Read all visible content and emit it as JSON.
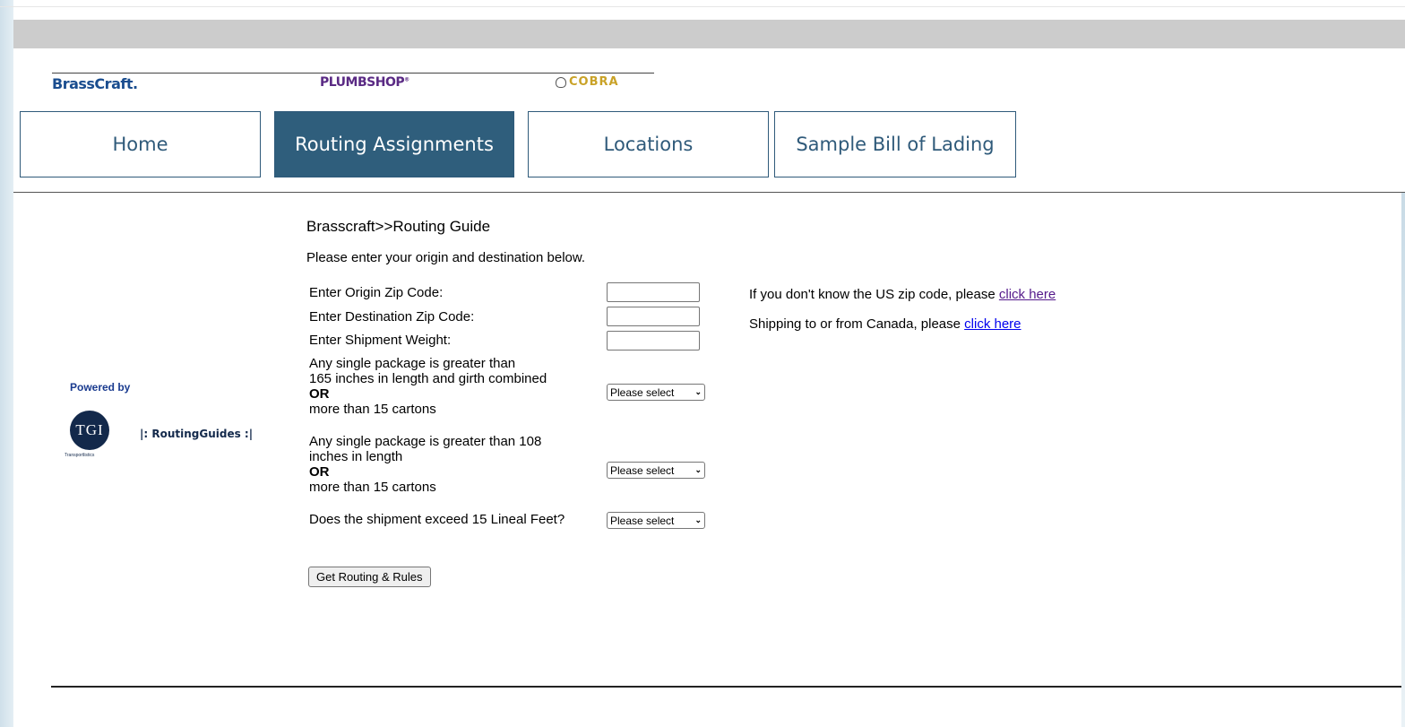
{
  "brands": {
    "brasscraft": "BrassCraft.",
    "plumbshop": "PLUMBSHOP",
    "plumbshop_mark": "®",
    "cobra": "COBRA"
  },
  "nav": {
    "tabs": [
      {
        "label": "Home"
      },
      {
        "label": "Routing Assignments",
        "active": true
      },
      {
        "label": "Locations"
      },
      {
        "label": "Sample Bill of Lading"
      }
    ]
  },
  "sidebar": {
    "powered_by": "Powered by",
    "tgi_logo": "TGI",
    "tgi_sub": "Transportlistics",
    "routingguides_logo": "|: RoutingGuides :|"
  },
  "main": {
    "breadcrumb": "Brasscraft>>Routing Guide",
    "intro": "Please enter your origin and destination below.",
    "fields": {
      "origin_label": "Enter Origin Zip Code:",
      "origin_value": "",
      "destination_label": "Enter Destination Zip Code:",
      "destination_value": "",
      "weight_label": "Enter Shipment Weight:",
      "weight_value": ""
    },
    "questions": {
      "q1_line1": "Any single package is greater than",
      "q1_line2": "165 inches in length and girth combined",
      "q1_or": "OR",
      "q1_line3": "more than 15 cartons",
      "q2_line1": "Any single package is greater than 108",
      "q2_line2": "inches in length",
      "q2_or": "OR",
      "q2_line3": "more than 15 cartons",
      "q3": "Does the shipment exceed 15 Lineal Feet?"
    },
    "select_placeholder": "Please select",
    "submit_label": "Get Routing & Rules"
  },
  "help": {
    "zip_text": "If you don't know the US zip code, please ",
    "zip_link": "click here",
    "canada_text": "Shipping to or from Canada, please ",
    "canada_link": "click here"
  },
  "colors": {
    "nav_active_bg": "#2f5e7c",
    "nav_border": "#2f5a7a",
    "visited_link": "#551a8b",
    "link": "#0000ee"
  }
}
